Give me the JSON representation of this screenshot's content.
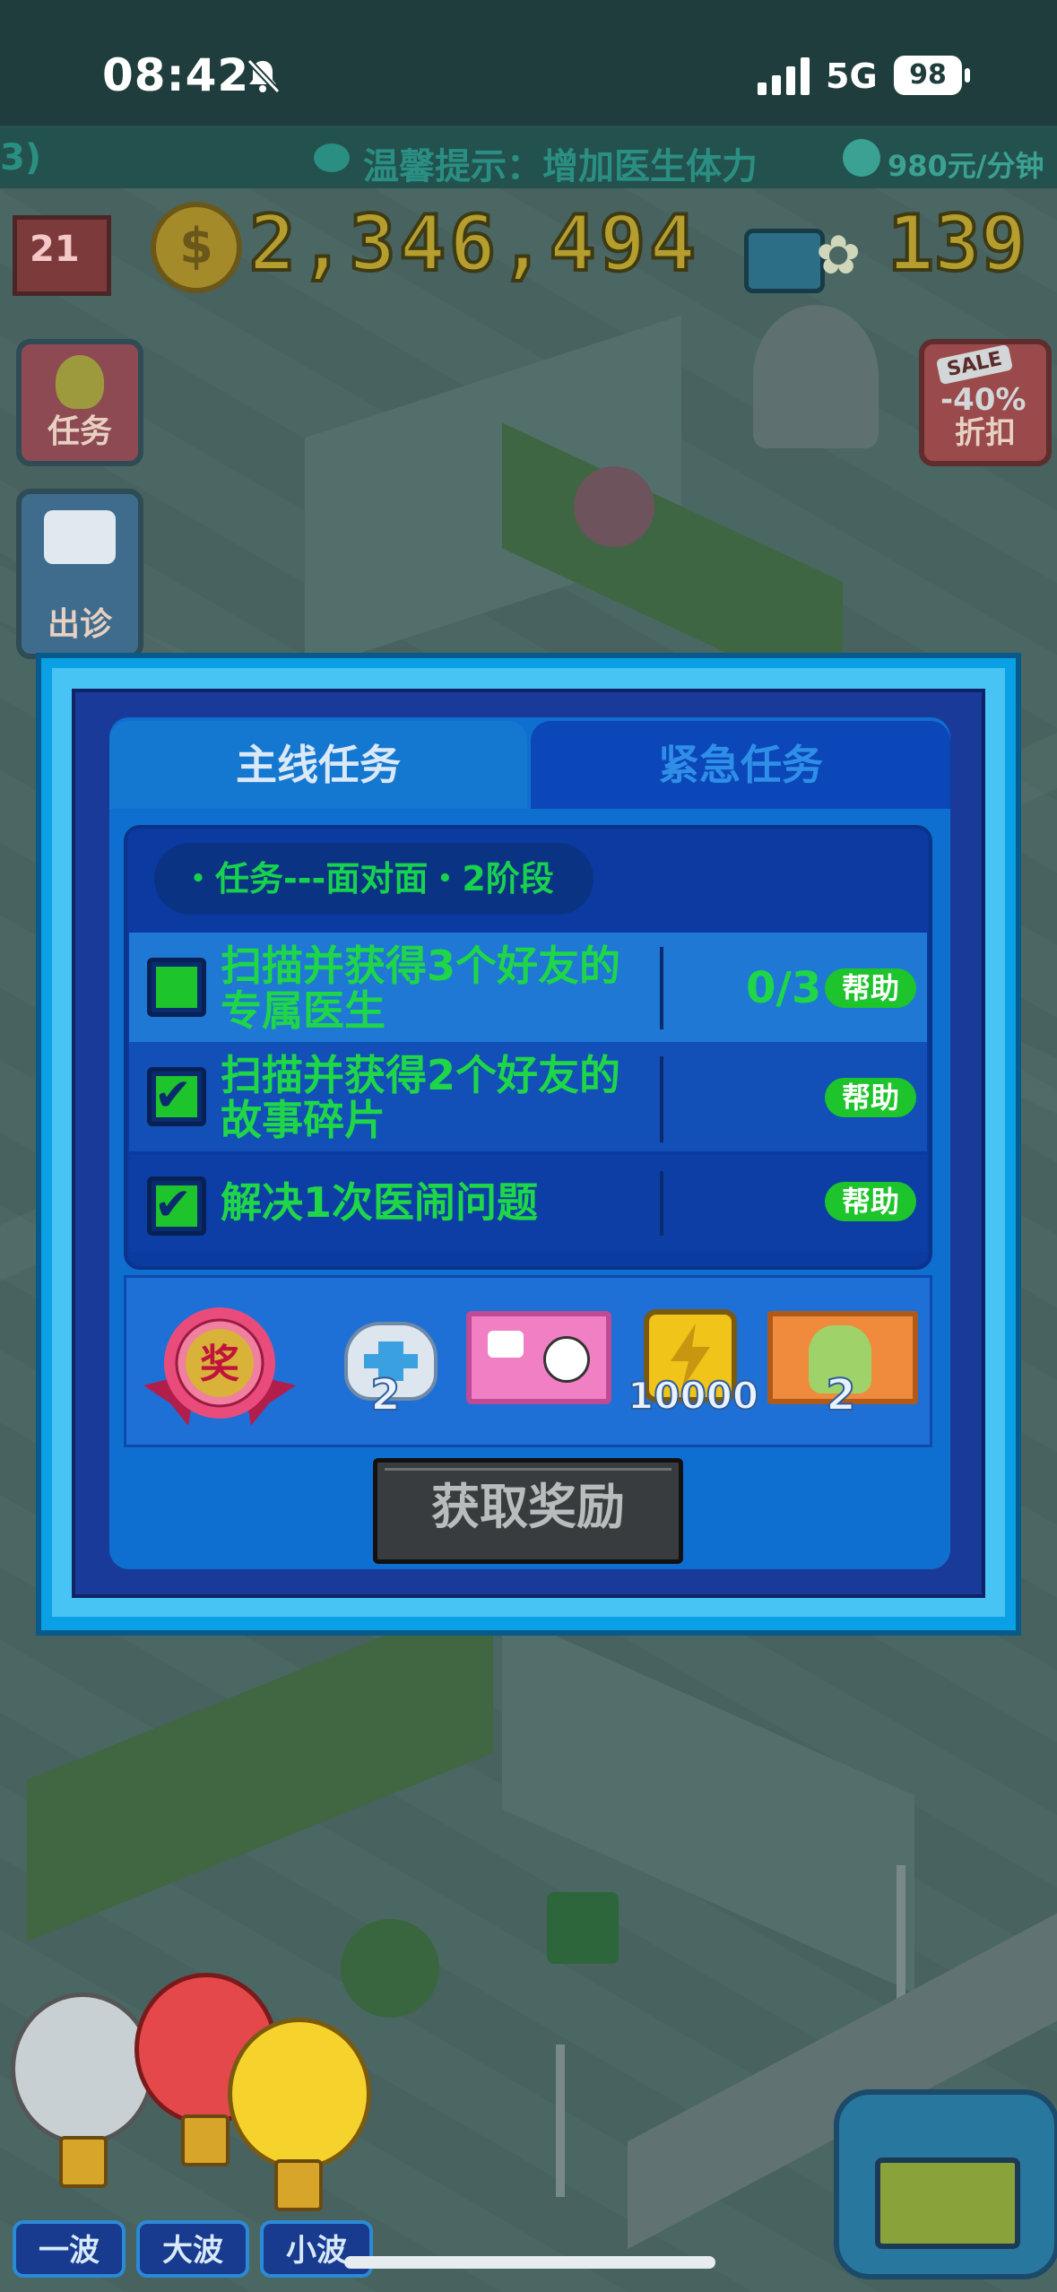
{
  "status_bar": {
    "time": "08:42",
    "network": "5G",
    "battery": "98"
  },
  "marquee": {
    "left_fragment": "3)",
    "tip": "温馨提示：增加医生体力",
    "rate": "980元/分钟"
  },
  "hud": {
    "level": "21",
    "money": "2,346,494",
    "gems": "139"
  },
  "side_buttons": {
    "task": "任务",
    "visit": "出诊",
    "sale_tag": "SALE",
    "sale_pct": "-40%",
    "sale": "折扣"
  },
  "dialog": {
    "tabs": [
      {
        "label": "主线任务",
        "active": true
      },
      {
        "label": "紧急任务",
        "active": false
      }
    ],
    "stage": "・任务---面对面・2阶段",
    "tasks": [
      {
        "line1": "扫描并获得3个好友的",
        "line2": "专属医生",
        "progress": "0/3",
        "help": "帮助",
        "done": false
      },
      {
        "line1": "扫描并获得2个好友的",
        "line2": "故事碎片",
        "progress": "",
        "help": "帮助",
        "done": true
      },
      {
        "line1": "解决1次医闹问题",
        "line2": "",
        "progress": "",
        "help": "帮助",
        "done": true
      }
    ],
    "medal_label": "奖",
    "rewards": [
      {
        "icon": "cat-medkit-icon",
        "count": "2"
      },
      {
        "icon": "doctor-card-icon",
        "count": ""
      },
      {
        "icon": "energy-icon",
        "count": "10000"
      },
      {
        "icon": "nurse-ticket-icon",
        "count": "2"
      }
    ],
    "claim_button": "获取奖励"
  },
  "waves": [
    "一波",
    "大波",
    "小波"
  ],
  "colors": {
    "dialog_blue": "#0f6fd0",
    "task_green": "#1fd648",
    "help_green": "#1dc42c"
  }
}
